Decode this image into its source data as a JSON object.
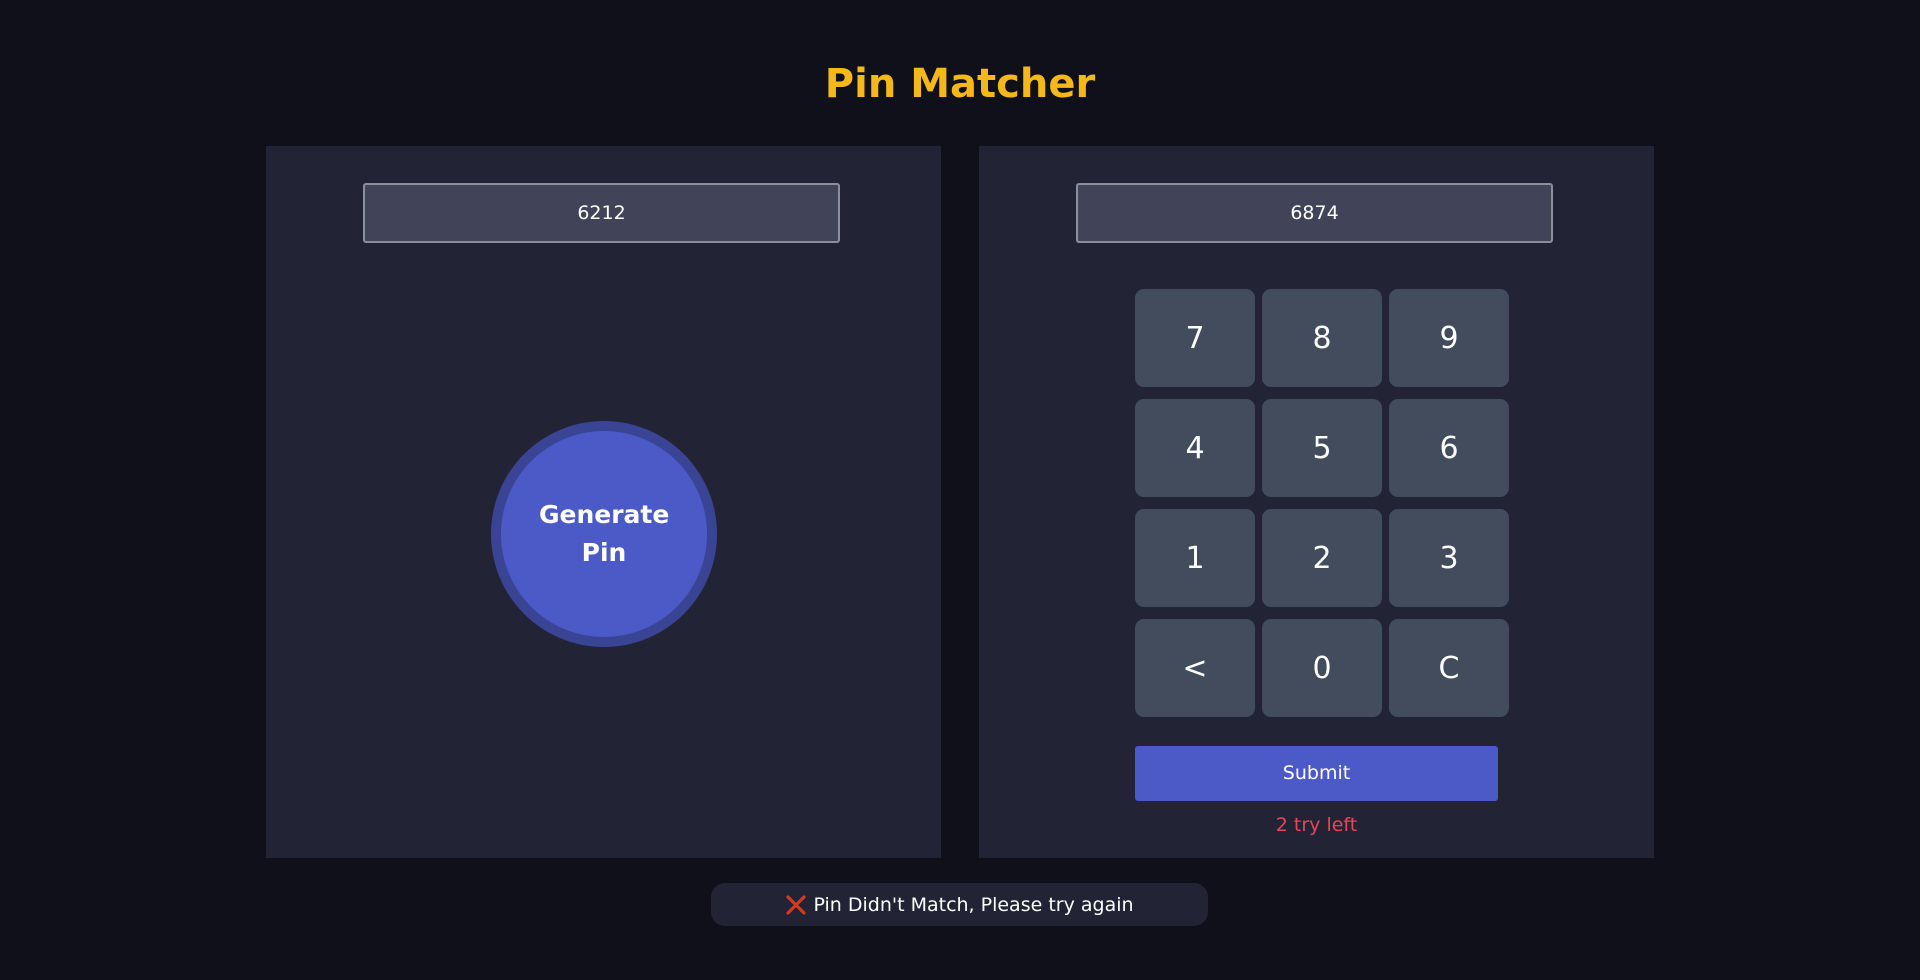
{
  "header": {
    "title": "Pin Matcher"
  },
  "generator": {
    "pin_value": "6212",
    "button_label": "Generate Pin"
  },
  "matcher": {
    "typed_value": "6874",
    "keys": [
      "7",
      "8",
      "9",
      "4",
      "5",
      "6",
      "1",
      "2",
      "3",
      "<",
      "0",
      "C"
    ],
    "submit_label": "Submit",
    "tries_left": "2 try left"
  },
  "notification": {
    "icon": "cross-icon",
    "message": "Pin Didn't Match, Please try again"
  },
  "colors": {
    "background": "#0f1019",
    "panel": "#222435",
    "accent": "#4b5ac7",
    "title": "#f5b81a",
    "error": "#e8455a",
    "key": "#424c5c"
  }
}
